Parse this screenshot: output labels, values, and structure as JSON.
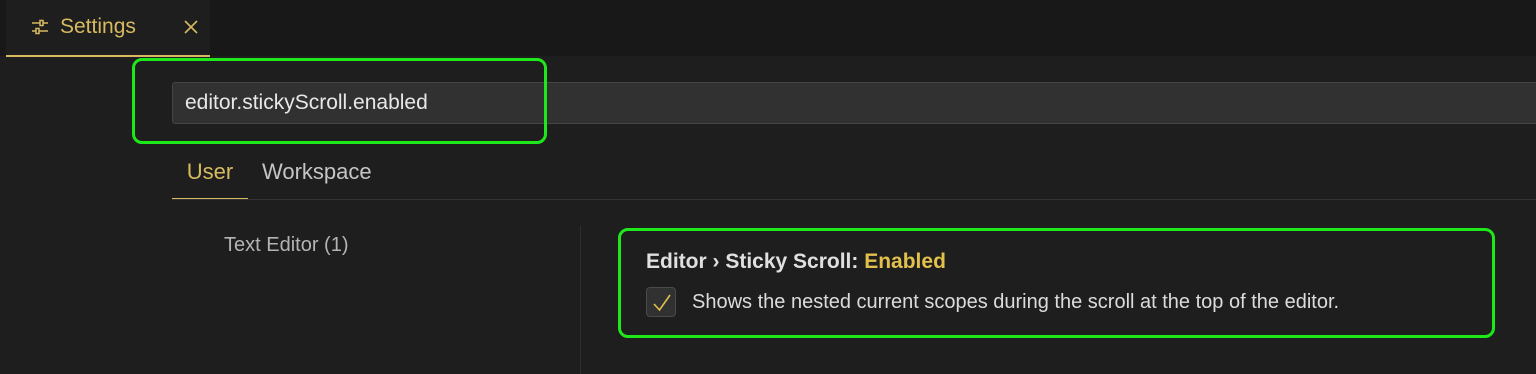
{
  "tab": {
    "icon": "settings-sliders-icon",
    "label": "Settings",
    "close_icon": "close-icon"
  },
  "search": {
    "value": "editor.stickyScroll.enabled"
  },
  "scope_tabs": [
    {
      "label": "User",
      "active": true
    },
    {
      "label": "Workspace",
      "active": false
    }
  ],
  "toc": {
    "item": "Text Editor (1)"
  },
  "setting": {
    "category": "Editor › Sticky Scroll: ",
    "key": "Enabled",
    "checked": true,
    "description": "Shows the nested current scopes during the scroll at the top of the editor."
  },
  "colors": {
    "accent": "#d7ba5f",
    "highlight_box": "#1ee81a",
    "background": "#1e1e1e"
  }
}
